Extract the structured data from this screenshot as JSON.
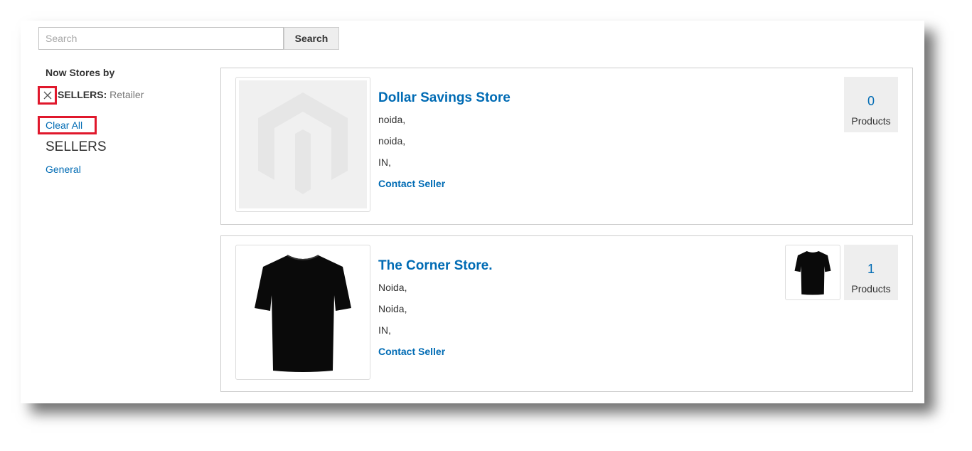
{
  "search": {
    "placeholder": "Search",
    "value": "",
    "button_label": "Search"
  },
  "sidebar": {
    "title": "Now Stores by",
    "active_filter": {
      "name": "SELLERS:",
      "value": "Retailer"
    },
    "clear_all_label": "Clear All",
    "filter_group": {
      "heading": "SELLERS",
      "options": [
        "General"
      ]
    }
  },
  "highlight_color": "#e0182c",
  "link_color": "#006bb4",
  "sellers": [
    {
      "name": "Dollar Savings Store",
      "address": [
        "noida,",
        "noida,",
        "IN,"
      ],
      "contact_label": "Contact Seller",
      "product_count": "0",
      "products_label": "Products",
      "logo_icon": "magento-placeholder-icon"
    },
    {
      "name": "The Corner Store.",
      "address": [
        "Noida,",
        "Noida,",
        "IN,"
      ],
      "contact_label": "Contact Seller",
      "product_count": "1",
      "products_label": "Products",
      "logo_icon": "black-tshirt-image"
    }
  ]
}
